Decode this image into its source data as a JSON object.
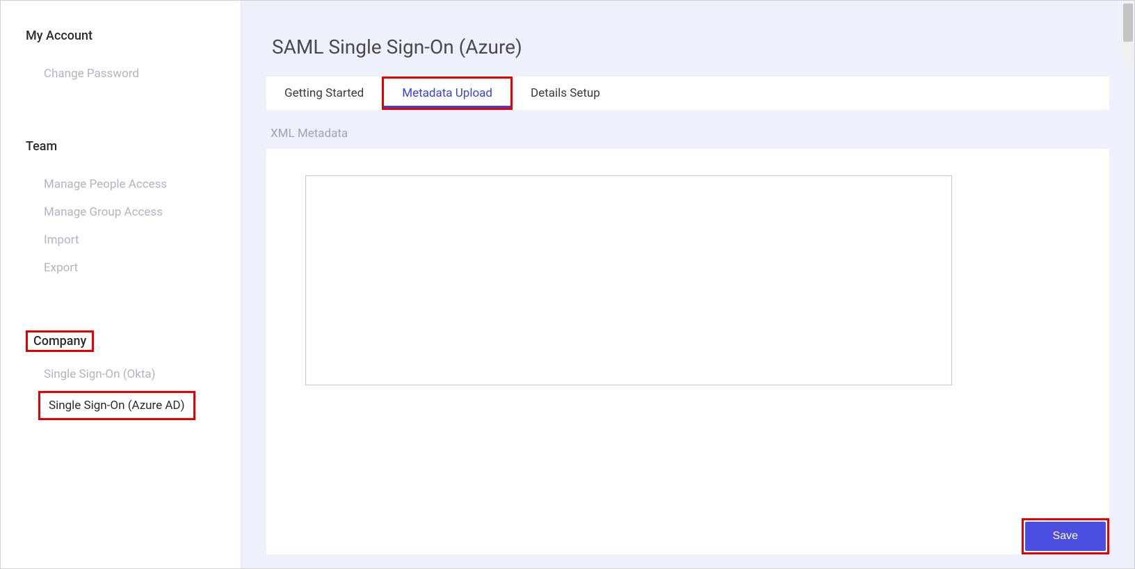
{
  "sidebar": {
    "sections": [
      {
        "header": "My Account",
        "items": [
          {
            "label": "Change Password",
            "active": false
          }
        ]
      },
      {
        "header": "Team",
        "items": [
          {
            "label": "Manage People Access",
            "active": false
          },
          {
            "label": "Manage Group Access",
            "active": false
          },
          {
            "label": "Import",
            "active": false
          },
          {
            "label": "Export",
            "active": false
          }
        ]
      },
      {
        "header": "Company",
        "items": [
          {
            "label": "Single Sign-On (Okta)",
            "active": false
          },
          {
            "label": "Single Sign-On (Azure AD)",
            "active": true
          }
        ]
      }
    ]
  },
  "main": {
    "title": "SAML Single Sign-On (Azure)",
    "tabs": [
      {
        "label": "Getting Started",
        "active": false
      },
      {
        "label": "Metadata Upload",
        "active": true
      },
      {
        "label": "Details Setup",
        "active": false
      }
    ],
    "section_label": "XML Metadata",
    "textarea_value": "",
    "save_label": "Save"
  }
}
